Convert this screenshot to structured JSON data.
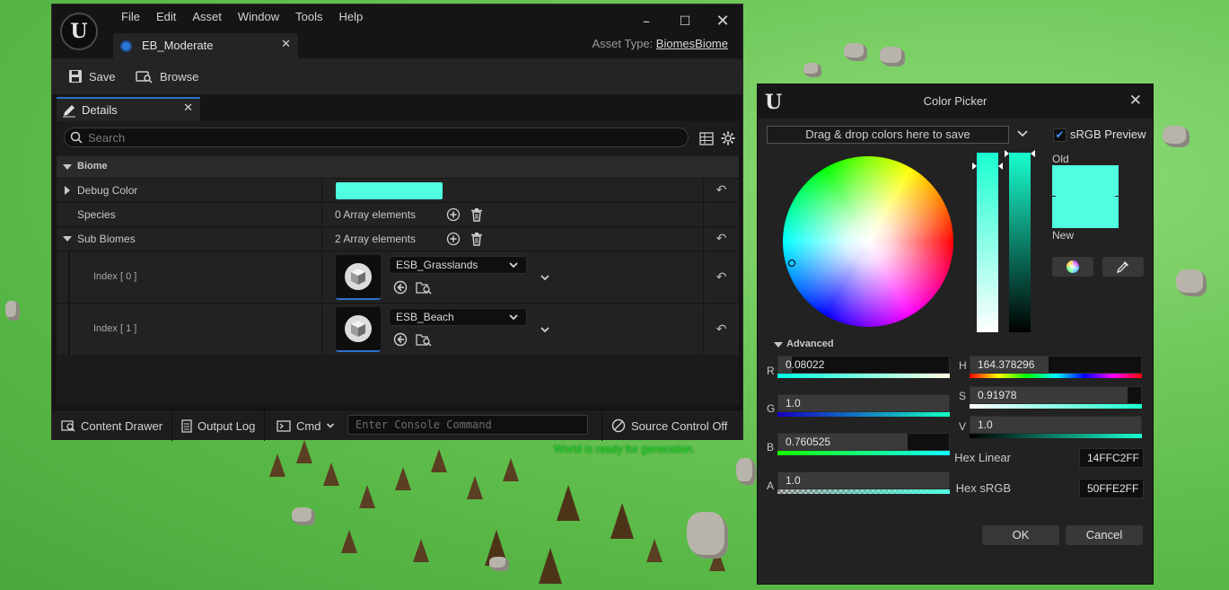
{
  "world_message": "World is ready for generation.",
  "editor": {
    "menu": [
      "File",
      "Edit",
      "Asset",
      "Window",
      "Tools",
      "Help"
    ],
    "doc_tab": "EB_Moderate",
    "asset_type_label": "Asset Type:",
    "asset_type_value": "BiomesBiome",
    "toolbar": {
      "save": "Save",
      "browse": "Browse"
    },
    "details_tab": "Details",
    "search_placeholder": "Search",
    "category": "Biome",
    "rows": {
      "debug_color": {
        "label": "Debug Color",
        "color": "#50FFE2"
      },
      "species": {
        "label": "Species",
        "value": "0 Array elements"
      },
      "sub_biomes": {
        "label": "Sub Biomes",
        "value": "2 Array elements"
      },
      "index0": {
        "label": "Index [ 0 ]",
        "asset": "ESB_Grasslands"
      },
      "index1": {
        "label": "Index [ 1 ]",
        "asset": "ESB_Beach"
      }
    },
    "status": {
      "content_drawer": "Content Drawer",
      "output_log": "Output Log",
      "cmd": "Cmd",
      "console_placeholder": "Enter Console Command",
      "source_control": "Source Control Off"
    }
  },
  "picker": {
    "title": "Color Picker",
    "drop_zone": "Drag & drop colors here to save",
    "srgb_preview": "sRGB Preview",
    "srgb_checked": true,
    "old_label": "Old",
    "new_label": "New",
    "advanced": "Advanced",
    "r": {
      "label": "R",
      "value": "0.08022",
      "fraction": 0.08
    },
    "g": {
      "label": "G",
      "value": "1.0",
      "fraction": 1.0
    },
    "b": {
      "label": "B",
      "value": "0.760525",
      "fraction": 0.76
    },
    "a": {
      "label": "A",
      "value": "1.0",
      "fraction": 1.0
    },
    "h": {
      "label": "H",
      "value": "164.378296",
      "fraction": 0.46
    },
    "s": {
      "label": "S",
      "value": "0.91978",
      "fraction": 0.92
    },
    "v": {
      "label": "V",
      "value": "1.0",
      "fraction": 1.0
    },
    "hex_linear_label": "Hex Linear",
    "hex_linear": "14FFC2FF",
    "hex_srgb_label": "Hex sRGB",
    "hex_srgb": "50FFE2FF",
    "ok": "OK",
    "cancel": "Cancel",
    "swatch_color": "#50FFE2"
  }
}
